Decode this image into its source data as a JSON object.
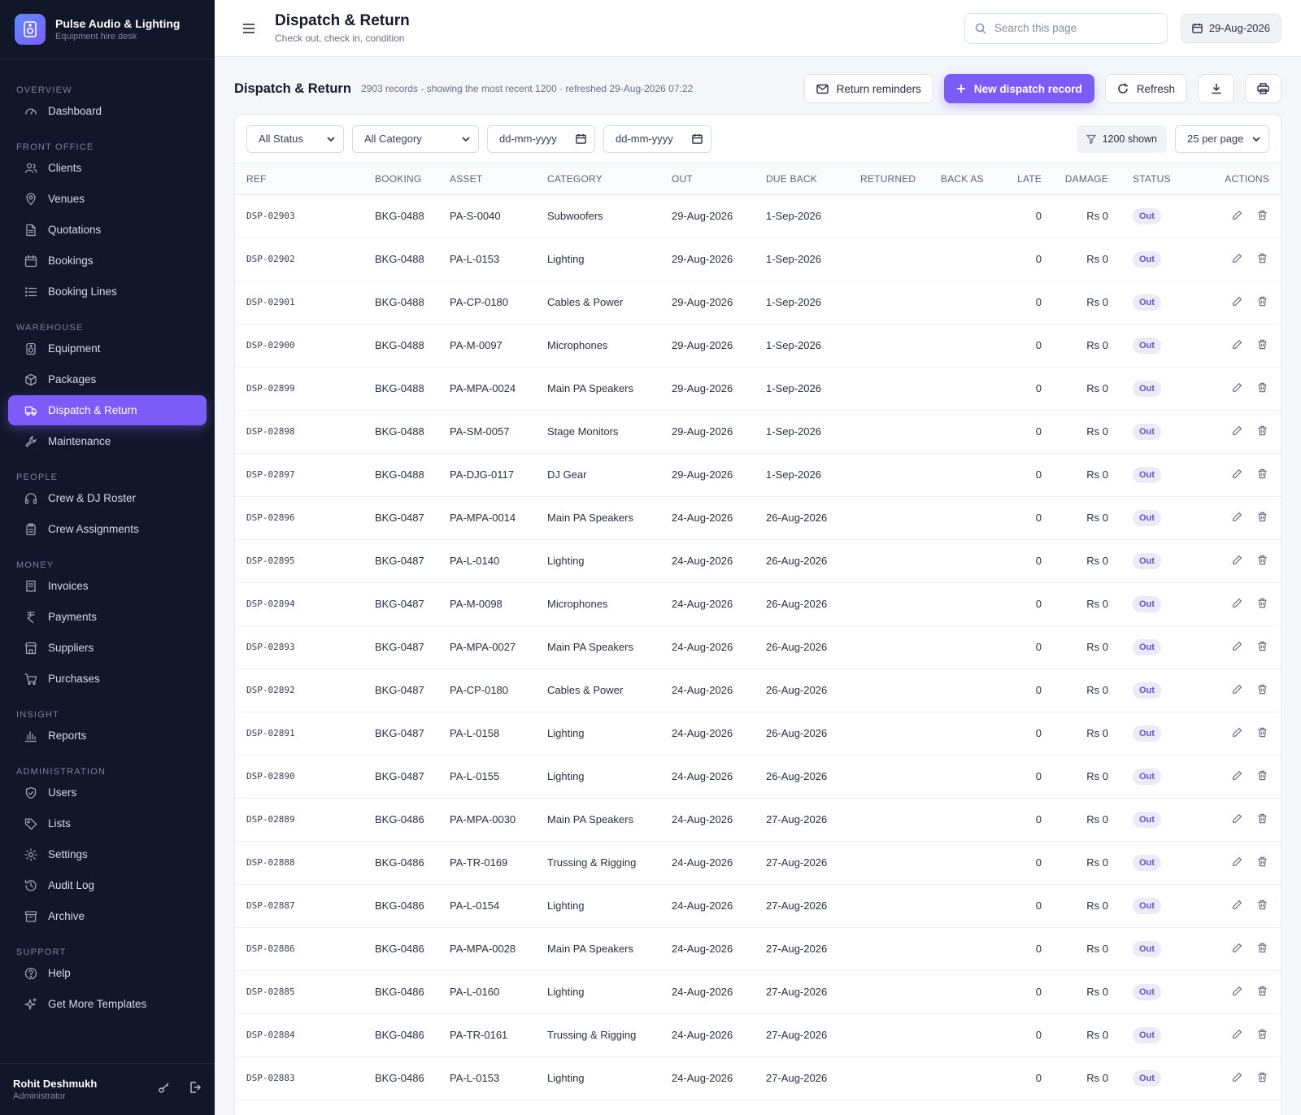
{
  "brand": {
    "name": "Pulse Audio & Lighting",
    "tagline": "Equipment hire desk"
  },
  "nav": [
    {
      "section": "OVERVIEW",
      "items": [
        {
          "label": "Dashboard",
          "icon": "gauge-icon"
        }
      ]
    },
    {
      "section": "FRONT OFFICE",
      "items": [
        {
          "label": "Clients",
          "icon": "users-icon"
        },
        {
          "label": "Venues",
          "icon": "map-pin-icon"
        },
        {
          "label": "Quotations",
          "icon": "document-icon"
        },
        {
          "label": "Bookings",
          "icon": "calendar-icon"
        },
        {
          "label": "Booking Lines",
          "icon": "list-icon"
        }
      ]
    },
    {
      "section": "WAREHOUSE",
      "items": [
        {
          "label": "Equipment",
          "icon": "speaker-icon"
        },
        {
          "label": "Packages",
          "icon": "box-icon"
        },
        {
          "label": "Dispatch & Return",
          "icon": "truck-icon",
          "active": true
        },
        {
          "label": "Maintenance",
          "icon": "wrench-icon"
        }
      ]
    },
    {
      "section": "PEOPLE",
      "items": [
        {
          "label": "Crew & DJ Roster",
          "icon": "headphones-icon"
        },
        {
          "label": "Crew Assignments",
          "icon": "clipboard-icon"
        }
      ]
    },
    {
      "section": "MONEY",
      "items": [
        {
          "label": "Invoices",
          "icon": "invoice-icon"
        },
        {
          "label": "Payments",
          "icon": "rupee-icon"
        },
        {
          "label": "Suppliers",
          "icon": "store-icon"
        },
        {
          "label": "Purchases",
          "icon": "cart-icon"
        }
      ]
    },
    {
      "section": "INSIGHT",
      "items": [
        {
          "label": "Reports",
          "icon": "bar-chart-icon"
        }
      ]
    },
    {
      "section": "ADMINISTRATION",
      "items": [
        {
          "label": "Users",
          "icon": "shield-icon"
        },
        {
          "label": "Lists",
          "icon": "tag-icon"
        },
        {
          "label": "Settings",
          "icon": "gear-icon"
        },
        {
          "label": "Audit Log",
          "icon": "history-icon"
        },
        {
          "label": "Archive",
          "icon": "archive-icon"
        }
      ]
    },
    {
      "section": "SUPPORT",
      "items": [
        {
          "label": "Help",
          "icon": "help-icon"
        },
        {
          "label": "Get More Templates",
          "icon": "sparkle-icon"
        }
      ]
    }
  ],
  "user": {
    "name": "Rohit Deshmukh",
    "role": "Administrator"
  },
  "header": {
    "title": "Dispatch & Return",
    "subtitle": "Check out, check in, condition",
    "search_placeholder": "Search this page",
    "date": "29-Aug-2026"
  },
  "page": {
    "title": "Dispatch & Return",
    "meta": "2903 records - showing the most recent 1200 · refreshed 29-Aug-2026 07:22",
    "btn_reminders": "Return reminders",
    "btn_new": "New dispatch record",
    "btn_refresh": "Refresh"
  },
  "filters": {
    "status": "All Status",
    "category": "All Category",
    "date_from": "dd-mm-yyyy",
    "date_to": "dd-mm-yyyy",
    "shown": "1200 shown",
    "per_page": "25 per page"
  },
  "columns": [
    "REF",
    "BOOKING",
    "ASSET",
    "CATEGORY",
    "OUT",
    "DUE BACK",
    "RETURNED",
    "BACK AS",
    "LATE",
    "DAMAGE",
    "STATUS",
    "ACTIONS"
  ],
  "rows": [
    [
      "DSP-02903",
      "BKG-0488",
      "PA-S-0040",
      "Subwoofers",
      "29-Aug-2026",
      "1-Sep-2026",
      "",
      "",
      "0",
      "Rs 0",
      "Out"
    ],
    [
      "DSP-02902",
      "BKG-0488",
      "PA-L-0153",
      "Lighting",
      "29-Aug-2026",
      "1-Sep-2026",
      "",
      "",
      "0",
      "Rs 0",
      "Out"
    ],
    [
      "DSP-02901",
      "BKG-0488",
      "PA-CP-0180",
      "Cables & Power",
      "29-Aug-2026",
      "1-Sep-2026",
      "",
      "",
      "0",
      "Rs 0",
      "Out"
    ],
    [
      "DSP-02900",
      "BKG-0488",
      "PA-M-0097",
      "Microphones",
      "29-Aug-2026",
      "1-Sep-2026",
      "",
      "",
      "0",
      "Rs 0",
      "Out"
    ],
    [
      "DSP-02899",
      "BKG-0488",
      "PA-MPA-0024",
      "Main PA Speakers",
      "29-Aug-2026",
      "1-Sep-2026",
      "",
      "",
      "0",
      "Rs 0",
      "Out"
    ],
    [
      "DSP-02898",
      "BKG-0488",
      "PA-SM-0057",
      "Stage Monitors",
      "29-Aug-2026",
      "1-Sep-2026",
      "",
      "",
      "0",
      "Rs 0",
      "Out"
    ],
    [
      "DSP-02897",
      "BKG-0488",
      "PA-DJG-0117",
      "DJ Gear",
      "29-Aug-2026",
      "1-Sep-2026",
      "",
      "",
      "0",
      "Rs 0",
      "Out"
    ],
    [
      "DSP-02896",
      "BKG-0487",
      "PA-MPA-0014",
      "Main PA Speakers",
      "24-Aug-2026",
      "26-Aug-2026",
      "",
      "",
      "0",
      "Rs 0",
      "Out"
    ],
    [
      "DSP-02895",
      "BKG-0487",
      "PA-L-0140",
      "Lighting",
      "24-Aug-2026",
      "26-Aug-2026",
      "",
      "",
      "0",
      "Rs 0",
      "Out"
    ],
    [
      "DSP-02894",
      "BKG-0487",
      "PA-M-0098",
      "Microphones",
      "24-Aug-2026",
      "26-Aug-2026",
      "",
      "",
      "0",
      "Rs 0",
      "Out"
    ],
    [
      "DSP-02893",
      "BKG-0487",
      "PA-MPA-0027",
      "Main PA Speakers",
      "24-Aug-2026",
      "26-Aug-2026",
      "",
      "",
      "0",
      "Rs 0",
      "Out"
    ],
    [
      "DSP-02892",
      "BKG-0487",
      "PA-CP-0180",
      "Cables & Power",
      "24-Aug-2026",
      "26-Aug-2026",
      "",
      "",
      "0",
      "Rs 0",
      "Out"
    ],
    [
      "DSP-02891",
      "BKG-0487",
      "PA-L-0158",
      "Lighting",
      "24-Aug-2026",
      "26-Aug-2026",
      "",
      "",
      "0",
      "Rs 0",
      "Out"
    ],
    [
      "DSP-02890",
      "BKG-0487",
      "PA-L-0155",
      "Lighting",
      "24-Aug-2026",
      "26-Aug-2026",
      "",
      "",
      "0",
      "Rs 0",
      "Out"
    ],
    [
      "DSP-02889",
      "BKG-0486",
      "PA-MPA-0030",
      "Main PA Speakers",
      "24-Aug-2026",
      "27-Aug-2026",
      "",
      "",
      "0",
      "Rs 0",
      "Out"
    ],
    [
      "DSP-02888",
      "BKG-0486",
      "PA-TR-0169",
      "Trussing & Rigging",
      "24-Aug-2026",
      "27-Aug-2026",
      "",
      "",
      "0",
      "Rs 0",
      "Out"
    ],
    [
      "DSP-02887",
      "BKG-0486",
      "PA-L-0154",
      "Lighting",
      "24-Aug-2026",
      "27-Aug-2026",
      "",
      "",
      "0",
      "Rs 0",
      "Out"
    ],
    [
      "DSP-02886",
      "BKG-0486",
      "PA-MPA-0028",
      "Main PA Speakers",
      "24-Aug-2026",
      "27-Aug-2026",
      "",
      "",
      "0",
      "Rs 0",
      "Out"
    ],
    [
      "DSP-02885",
      "BKG-0486",
      "PA-L-0160",
      "Lighting",
      "24-Aug-2026",
      "27-Aug-2026",
      "",
      "",
      "0",
      "Rs 0",
      "Out"
    ],
    [
      "DSP-02884",
      "BKG-0486",
      "PA-TR-0161",
      "Trussing & Rigging",
      "24-Aug-2026",
      "27-Aug-2026",
      "",
      "",
      "0",
      "Rs 0",
      "Out"
    ],
    [
      "DSP-02883",
      "BKG-0486",
      "PA-L-0153",
      "Lighting",
      "24-Aug-2026",
      "27-Aug-2026",
      "",
      "",
      "0",
      "Rs 0",
      "Out"
    ]
  ],
  "colors": {
    "accent": "#7c5cf6",
    "sidebar_bg": "#111629",
    "badge_bg": "#ece9f8",
    "badge_text": "#6a55c9"
  }
}
